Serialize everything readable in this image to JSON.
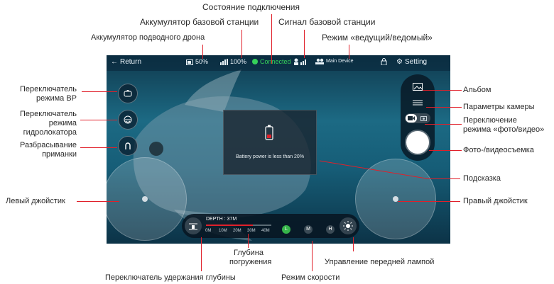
{
  "callouts": {
    "connection_status": "Состояние подключения",
    "base_battery": "Аккумулятор базовой станции",
    "base_signal": "Сигнал базовой станции",
    "drone_battery": "Аккумулятор подводного дрона",
    "master_slave": "Режим «ведущий/ведомый»",
    "vr_mode_l1": "Переключатель",
    "vr_mode_l2": "режима ВР",
    "sonar_mode_l1": "Переключатель",
    "sonar_mode_l2": "режима",
    "sonar_mode_l3": "гидролокатора",
    "bait_l1": "Разбрасывание",
    "bait_l2": "приманки",
    "left_joystick": "Левый джойстик",
    "album": "Альбом",
    "camera_params": "Параметры камеры",
    "photo_video_l1": "Переключение",
    "photo_video_l2": "режима «фото/видео»",
    "shutter": "Фото-/видеосъемка",
    "hint": "Подсказка",
    "right_joystick": "Правый джойстик",
    "depth_l1": "Глубина",
    "depth_l2": "погружения",
    "front_lamp": "Управление передней лампой",
    "depth_hold": "Переключатель удержания глубины",
    "speed_mode": "Режим скорости"
  },
  "top_bar": {
    "return_label": "Return",
    "drone_battery": "50%",
    "base_battery": "100%",
    "connection": "Connected",
    "device_mode": "Main Device",
    "setting_label": "Setting"
  },
  "warning": {
    "message": "Battery power is less than 20%"
  },
  "depth": {
    "label": "DEPTH : 37M",
    "ticks": [
      "0M",
      "10M",
      "20M",
      "30M",
      "40M"
    ]
  },
  "speed_modes": [
    "L",
    "M",
    "H"
  ],
  "colors": {
    "leader": "#e0202a",
    "connected": "#36d25a",
    "speed_active": "#36b54a",
    "battery_warning": "#e0202a"
  },
  "icons": {
    "vr": "vr-headset-icon",
    "sonar": "sonar-icon",
    "bait": "bait-drop-icon",
    "album": "album-icon",
    "camera_params": "sliders-icon",
    "video_mode": "video-camera-icon",
    "photo_mode": "photo-camera-icon",
    "lamp": "lamp-icon",
    "depth_hold": "depth-hold-icon"
  }
}
